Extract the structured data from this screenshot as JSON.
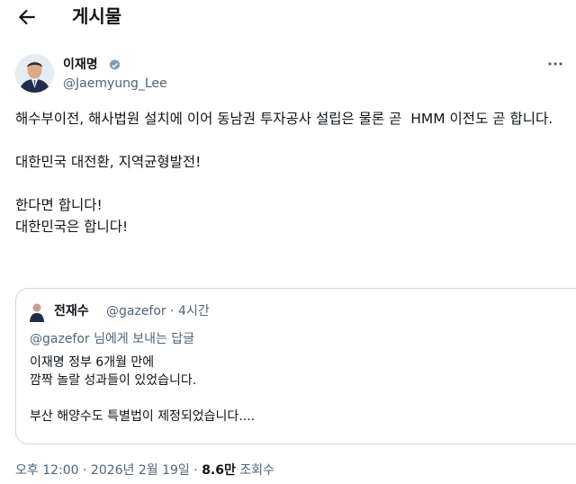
{
  "header": {
    "back_icon": "arrow-left-icon",
    "title": "게시물"
  },
  "author": {
    "name": "이재명",
    "handle": "@Jaemyung_Lee",
    "verified_icon": "verified-badge-icon",
    "more_icon": "more-horizontal-icon"
  },
  "post": {
    "paragraphs": [
      "해수부이전, 해사법원 설치에 이어 동남권 투자공사 설립은 물론 곧  HMM 이전도 곧 합니다.",
      "대한민국 대전환, 지역균형발전!",
      "한다면 합니다!\n대한민국은 합니다!"
    ]
  },
  "quote": {
    "name": "전재수",
    "handle": "@gazefor",
    "separator": "·",
    "time": "4시간",
    "reply_to": "@gazefor 님에게 보내는 답글",
    "paragraphs": [
      "이재명 정부 6개월 만에\n깜짝 놀랄 성과들이 있었습니다.",
      "부산 해양수도 특별법이 제정되었습니다...."
    ]
  },
  "footer": {
    "time": "오후 12:00",
    "separator": "·",
    "date": "2026년 2월 19일",
    "views_count": "8.6만",
    "views_label": "조회수"
  },
  "colors": {
    "text": "#0f1419",
    "secondary": "#536471",
    "border": "#cfd9de",
    "verified": "#829aab"
  }
}
